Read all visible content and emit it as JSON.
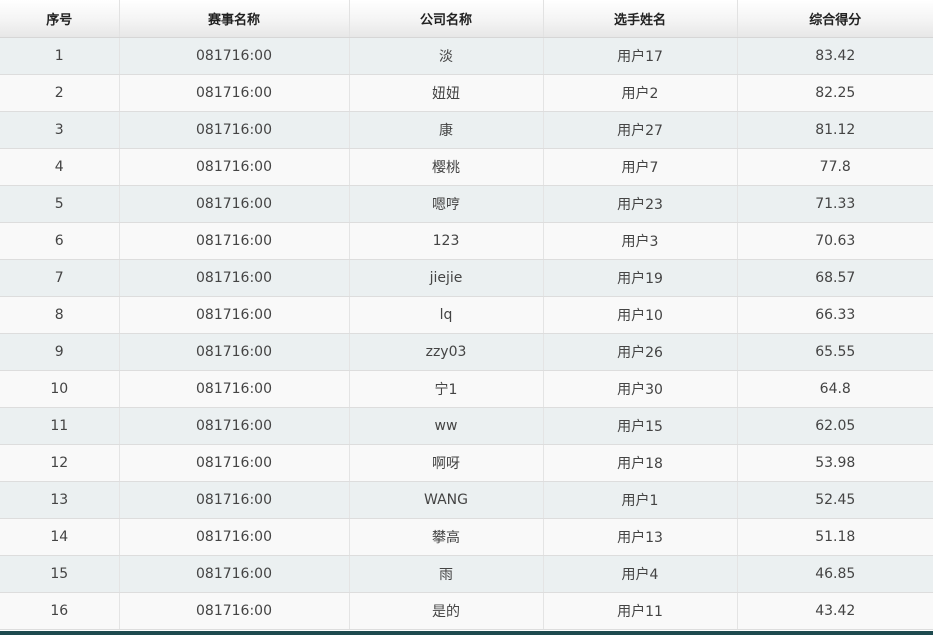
{
  "table": {
    "headers": [
      "序号",
      "赛事名称",
      "公司名称",
      "选手姓名",
      "综合得分"
    ],
    "rows": [
      {
        "index": "1",
        "event": "081716:00",
        "company": "淡",
        "player": "用户17",
        "score": "83.42"
      },
      {
        "index": "2",
        "event": "081716:00",
        "company": "妞妞",
        "player": "用户2",
        "score": "82.25"
      },
      {
        "index": "3",
        "event": "081716:00",
        "company": "康",
        "player": "用户27",
        "score": "81.12"
      },
      {
        "index": "4",
        "event": "081716:00",
        "company": "樱桃",
        "player": "用户7",
        "score": "77.8"
      },
      {
        "index": "5",
        "event": "081716:00",
        "company": "嗯哼",
        "player": "用户23",
        "score": "71.33"
      },
      {
        "index": "6",
        "event": "081716:00",
        "company": "123",
        "player": "用户3",
        "score": "70.63"
      },
      {
        "index": "7",
        "event": "081716:00",
        "company": "jiejie",
        "player": "用户19",
        "score": "68.57"
      },
      {
        "index": "8",
        "event": "081716:00",
        "company": "lq",
        "player": "用户10",
        "score": "66.33"
      },
      {
        "index": "9",
        "event": "081716:00",
        "company": "zzy03",
        "player": "用户26",
        "score": "65.55"
      },
      {
        "index": "10",
        "event": "081716:00",
        "company": "宁1",
        "player": "用户30",
        "score": "64.8"
      },
      {
        "index": "11",
        "event": "081716:00",
        "company": "ww",
        "player": "用户15",
        "score": "62.05"
      },
      {
        "index": "12",
        "event": "081716:00",
        "company": "啊呀",
        "player": "用户18",
        "score": "53.98"
      },
      {
        "index": "13",
        "event": "081716:00",
        "company": "WANG",
        "player": "用户1",
        "score": "52.45"
      },
      {
        "index": "14",
        "event": "081716:00",
        "company": "攀高",
        "player": "用户13",
        "score": "51.18"
      },
      {
        "index": "15",
        "event": "081716:00",
        "company": "雨",
        "player": "用户4",
        "score": "46.85"
      },
      {
        "index": "16",
        "event": "081716:00",
        "company": "是的",
        "player": "用户11",
        "score": "43.42"
      }
    ]
  },
  "colors": {
    "row_odd": "#ebf0f1",
    "row_even": "#f9f9f9",
    "bottom_bar": "#1e4a4f"
  }
}
